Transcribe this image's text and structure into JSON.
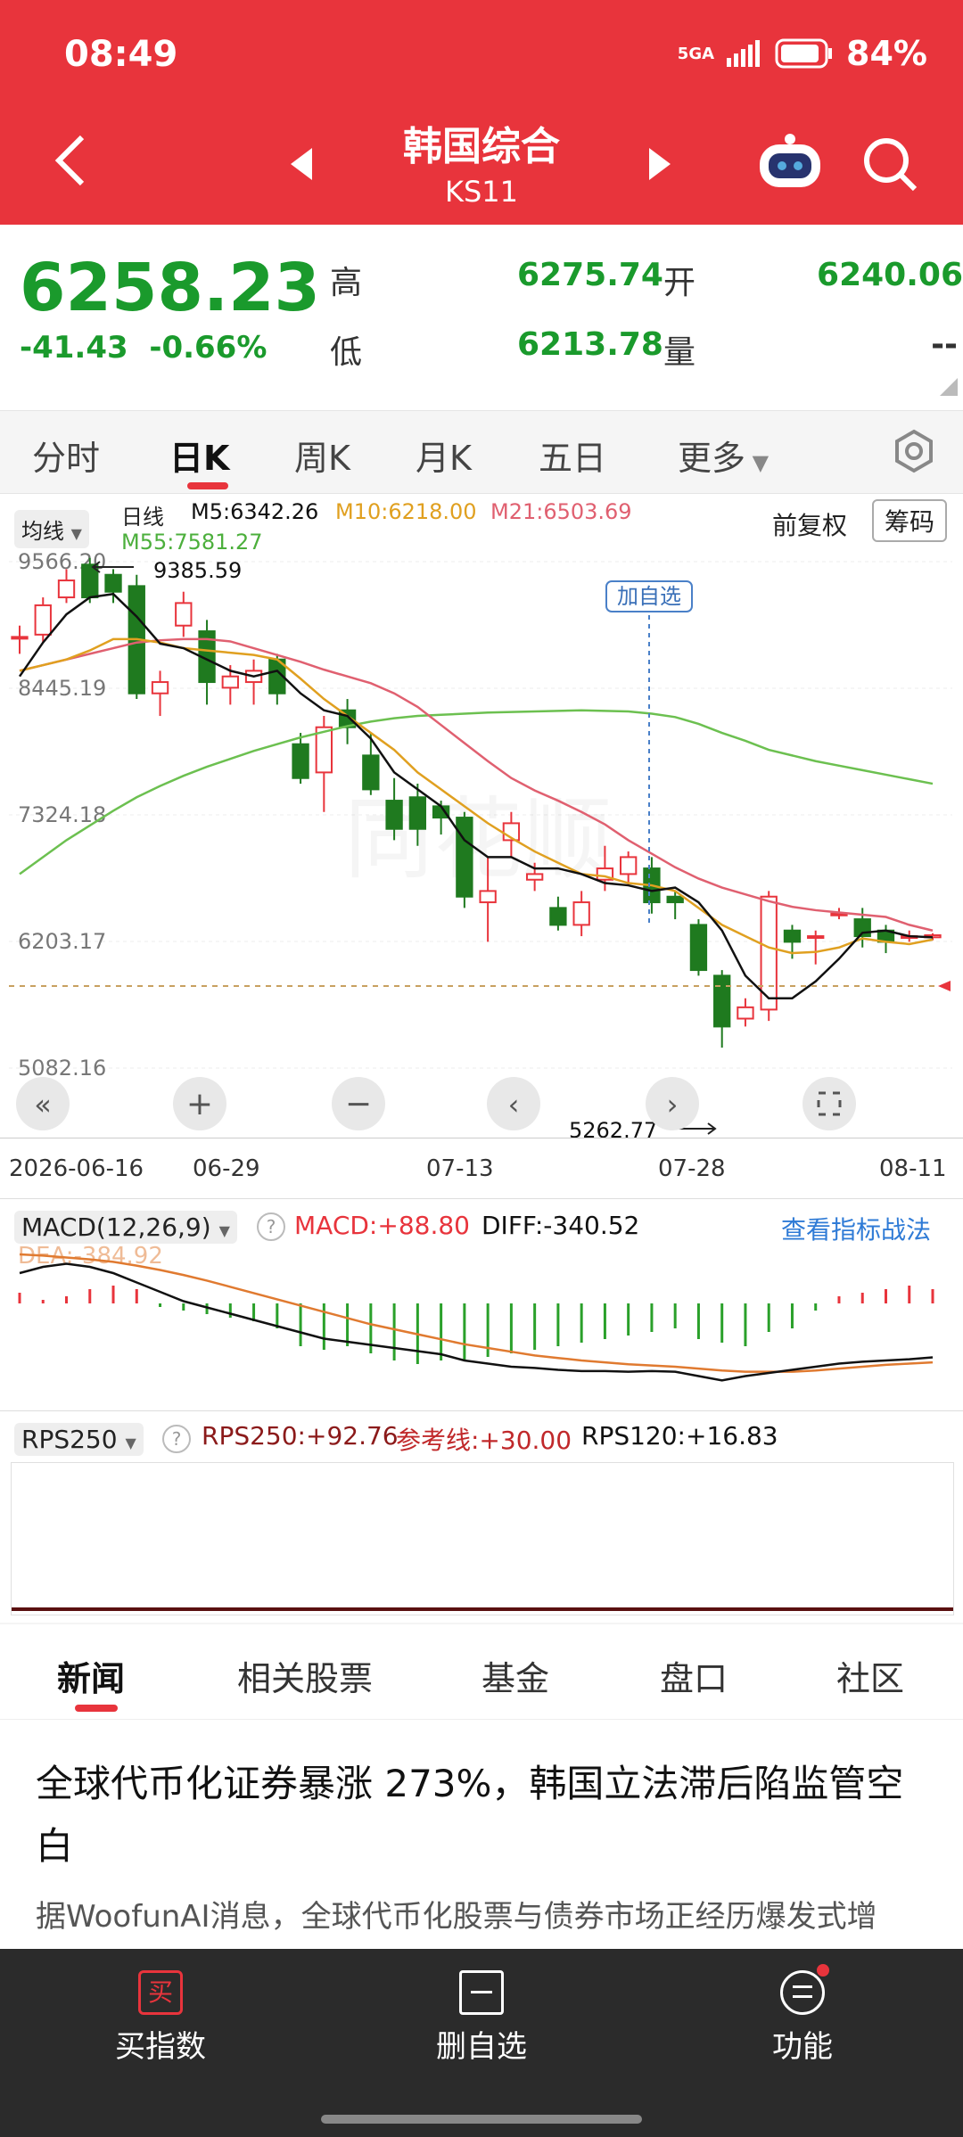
{
  "status": {
    "time": "08:49",
    "network": "5GA",
    "battery": "84%"
  },
  "header": {
    "title": "韩国综合",
    "code": "KS11"
  },
  "quote": {
    "price": "6258.23",
    "change": "-41.43",
    "change_pct": "-0.66%",
    "high_label": "高",
    "high": "6275.74",
    "low_label": "低",
    "low": "6213.78",
    "open_label": "开",
    "open": "6240.06",
    "volume_label": "量",
    "volume": "--"
  },
  "tabs": [
    "分时",
    "日K",
    "周K",
    "月K",
    "五日",
    "更多"
  ],
  "legend": {
    "ma_select": "均线",
    "daily": "日线",
    "m5": "M5:6342.26",
    "m10": "M10:6218.00",
    "m21": "M21:6503.69",
    "m55": "M55:7581.27",
    "adjust": "前复权",
    "chips": "筹码"
  },
  "kline": {
    "y_ticks": [
      "9566.20",
      "8445.19",
      "7324.18",
      "6203.17",
      "5082.16"
    ],
    "x_ticks": [
      "2026-06-16",
      "06-29",
      "07-13",
      "07-28",
      "08-11"
    ],
    "max_note": "9385.59",
    "min_note": "5262.77",
    "add_watch": "加自选"
  },
  "macd": {
    "select": "MACD(12,26,9)",
    "macd": "MACD:+88.80",
    "diff": "DIFF:-340.52",
    "dea": "DEA:-384.92",
    "link": "查看指标战法"
  },
  "rps": {
    "select": "RPS250",
    "rps250": "RPS250:+92.76",
    "ref": "参考线:+30.00",
    "rps120": "RPS120:+16.83"
  },
  "news_tabs": [
    "新闻",
    "相关股票",
    "基金",
    "盘口",
    "社区"
  ],
  "article": {
    "title": "全球代币化证券暴涨 273%，韩国立法滞后陷监管空白",
    "snippet": "据WoofunAI消息，全球代币化股票与债券市场正经历爆发式增"
  },
  "footer": {
    "buy": "买指数",
    "buy_icon": "买",
    "remove": "删自选",
    "func": "功能"
  },
  "colors": {
    "red": "#e8343c",
    "green": "#1a9a2c",
    "m5": "#111111",
    "m10": "#e0a020",
    "m21": "#e06070",
    "m55": "#6cc050"
  },
  "chart_data": {
    "type": "candlestick",
    "y_ticks": [
      9566.2,
      8445.19,
      7324.18,
      6203.17,
      5082.16
    ],
    "x_labels": [
      "2026-06-16",
      "06-29",
      "07-13",
      "07-28",
      "08-11"
    ],
    "candles": [
      {
        "o": 8900,
        "c": 8900,
        "h": 9000,
        "l": 8750
      },
      {
        "o": 8920,
        "c": 9180,
        "h": 9250,
        "l": 8850
      },
      {
        "o": 9250,
        "c": 9400,
        "h": 9500,
        "l": 9200
      },
      {
        "o": 9540,
        "c": 9250,
        "h": 9600,
        "l": 9200
      },
      {
        "o": 9450,
        "c": 9300,
        "h": 9500,
        "l": 9200
      },
      {
        "o": 9350,
        "c": 8400,
        "h": 9450,
        "l": 8350
      },
      {
        "o": 8400,
        "c": 8500,
        "h": 8600,
        "l": 8200
      },
      {
        "o": 9000,
        "c": 9200,
        "h": 9300,
        "l": 8900
      },
      {
        "o": 8950,
        "c": 8500,
        "h": 9050,
        "l": 8300
      },
      {
        "o": 8450,
        "c": 8550,
        "h": 8650,
        "l": 8300
      },
      {
        "o": 8500,
        "c": 8600,
        "h": 8700,
        "l": 8300
      },
      {
        "o": 8700,
        "c": 8400,
        "h": 8750,
        "l": 8300
      },
      {
        "o": 7950,
        "c": 7650,
        "h": 8050,
        "l": 7600
      },
      {
        "o": 7700,
        "c": 8100,
        "h": 8200,
        "l": 7350
      },
      {
        "o": 8250,
        "c": 8100,
        "h": 8350,
        "l": 7950
      },
      {
        "o": 7850,
        "c": 7550,
        "h": 8050,
        "l": 7500
      },
      {
        "o": 7450,
        "c": 7200,
        "h": 7650,
        "l": 7100
      },
      {
        "o": 7480,
        "c": 7200,
        "h": 7600,
        "l": 7050
      },
      {
        "o": 7400,
        "c": 7300,
        "h": 7450,
        "l": 7150
      },
      {
        "o": 7300,
        "c": 6600,
        "h": 7350,
        "l": 6500
      },
      {
        "o": 6550,
        "c": 6650,
        "h": 6950,
        "l": 6200
      },
      {
        "o": 7100,
        "c": 7250,
        "h": 7350,
        "l": 6950
      },
      {
        "o": 6750,
        "c": 6800,
        "h": 6900,
        "l": 6650
      },
      {
        "o": 6500,
        "c": 6350,
        "h": 6600,
        "l": 6300
      },
      {
        "o": 6350,
        "c": 6550,
        "h": 6650,
        "l": 6250
      },
      {
        "o": 6750,
        "c": 6850,
        "h": 7050,
        "l": 6650
      },
      {
        "o": 6800,
        "c": 6950,
        "h": 7000,
        "l": 6700
      },
      {
        "o": 6850,
        "c": 6550,
        "h": 6950,
        "l": 6450
      },
      {
        "o": 6600,
        "c": 6550,
        "h": 6650,
        "l": 6400
      },
      {
        "o": 6350,
        "c": 5950,
        "h": 6400,
        "l": 5900
      },
      {
        "o": 5900,
        "c": 5450,
        "h": 5950,
        "l": 5262.77
      },
      {
        "o": 5520,
        "c": 5620,
        "h": 5700,
        "l": 5450
      },
      {
        "o": 5600,
        "c": 6600,
        "h": 6650,
        "l": 5500
      },
      {
        "o": 6300,
        "c": 6200,
        "h": 6350,
        "l": 6050
      },
      {
        "o": 6250,
        "c": 6250,
        "h": 6300,
        "l": 6000
      },
      {
        "o": 6450,
        "c": 6450,
        "h": 6500,
        "l": 6400
      },
      {
        "o": 6400,
        "c": 6250,
        "h": 6500,
        "l": 6150
      },
      {
        "o": 6300,
        "c": 6200,
        "h": 6350,
        "l": 6100
      },
      {
        "o": 6250,
        "c": 6250,
        "h": 6300,
        "l": 6200
      },
      {
        "o": 6240.06,
        "c": 6258.23,
        "h": 6275.74,
        "l": 6213.78
      }
    ],
    "m5": [
      8550,
      8850,
      9100,
      9250,
      9280,
      9080,
      8840,
      8800,
      8700,
      8600,
      8550,
      8600,
      8400,
      8250,
      8200,
      8000,
      7700,
      7550,
      7400,
      7100,
      6950,
      6950,
      6850,
      6850,
      6800,
      6720,
      6700,
      6650,
      6680,
      6550,
      6300,
      5900,
      5700,
      5700,
      5850,
      6050,
      6280,
      6300,
      6250,
      6240
    ],
    "m10": [
      8600,
      8650,
      8700,
      8780,
      8880,
      8880,
      8850,
      8800,
      8780,
      8760,
      8740,
      8700,
      8530,
      8350,
      8200,
      8050,
      7900,
      7700,
      7550,
      7400,
      7250,
      7120,
      7000,
      6900,
      6800,
      6780,
      6720,
      6700,
      6650,
      6500,
      6350,
      6250,
      6150,
      6100,
      6110,
      6150,
      6230,
      6200,
      6180,
      6220
    ],
    "m21": [
      8600,
      8650,
      8700,
      8750,
      8800,
      8850,
      8870,
      8880,
      8880,
      8860,
      8800,
      8740,
      8680,
      8610,
      8550,
      8490,
      8400,
      8280,
      8120,
      7960,
      7800,
      7650,
      7540,
      7450,
      7350,
      7240,
      7100,
      6980,
      6860,
      6760,
      6680,
      6620,
      6560,
      6510,
      6480,
      6460,
      6440,
      6420,
      6350,
      6300
    ],
    "m55": [
      6800,
      6950,
      7100,
      7230,
      7360,
      7480,
      7580,
      7670,
      7750,
      7820,
      7890,
      7950,
      8010,
      8060,
      8110,
      8150,
      8180,
      8200,
      8210,
      8220,
      8230,
      8235,
      8240,
      8245,
      8250,
      8245,
      8240,
      8220,
      8190,
      8130,
      8050,
      7980,
      7900,
      7850,
      7800,
      7760,
      7720,
      7680,
      7640,
      7600
    ],
    "macd_hist": [
      0.15,
      0.05,
      0.1,
      0.2,
      0.25,
      0.2,
      -0.05,
      -0.1,
      -0.15,
      -0.2,
      -0.25,
      -0.35,
      -0.6,
      -0.65,
      -0.6,
      -0.7,
      -0.8,
      -0.85,
      -0.8,
      -0.8,
      -0.75,
      -0.7,
      -0.65,
      -0.6,
      -0.55,
      -0.5,
      -0.45,
      -0.4,
      -0.35,
      -0.5,
      -0.55,
      -0.6,
      -0.4,
      -0.35,
      -0.1,
      0.1,
      0.15,
      0.2,
      0.25,
      0.2
    ],
    "diff_line": [
      0.6,
      0.7,
      0.75,
      0.7,
      0.6,
      0.45,
      0.3,
      0.15,
      0.05,
      -0.05,
      -0.15,
      -0.25,
      -0.35,
      -0.45,
      -0.5,
      -0.55,
      -0.6,
      -0.65,
      -0.7,
      -0.8,
      -0.85,
      -0.9,
      -0.92,
      -0.95,
      -0.97,
      -0.97,
      -0.98,
      -0.97,
      -0.98,
      -1.05,
      -1.12,
      -1.05,
      -1.0,
      -0.95,
      -0.9,
      -0.85,
      -0.82,
      -0.8,
      -0.78,
      -0.75
    ],
    "dea_line": [
      0.9,
      0.88,
      0.85,
      0.82,
      0.78,
      0.72,
      0.65,
      0.57,
      0.48,
      0.38,
      0.28,
      0.18,
      0.08,
      -0.02,
      -0.12,
      -0.22,
      -0.3,
      -0.38,
      -0.46,
      -0.54,
      -0.6,
      -0.66,
      -0.72,
      -0.76,
      -0.8,
      -0.83,
      -0.86,
      -0.88,
      -0.9,
      -0.93,
      -0.96,
      -0.98,
      -0.98,
      -0.98,
      -0.96,
      -0.93,
      -0.9,
      -0.87,
      -0.85,
      -0.83
    ]
  }
}
